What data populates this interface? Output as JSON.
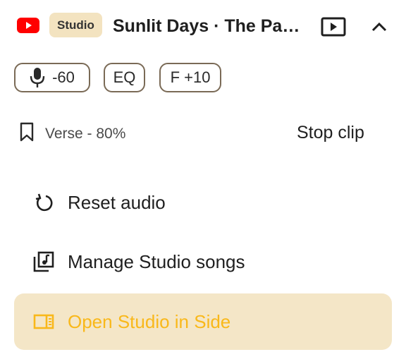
{
  "header": {
    "badge": "Studio",
    "title": "Sunlit Days · The Paper Lanterns",
    "logo_icon": "youtube-logo-icon",
    "video_icon": "video-play-icon",
    "collapse_icon": "chevron-up-icon"
  },
  "chips": {
    "mic": {
      "icon": "microphone-icon",
      "label": "-60"
    },
    "eq": {
      "label": "EQ"
    },
    "f": {
      "label": "F +10"
    }
  },
  "bookmark": {
    "icon": "bookmark-icon",
    "label": "Verse - 80%",
    "stop_label": "Stop clip"
  },
  "menu": {
    "items": [
      {
        "icon": "reset-icon",
        "label": "Reset audio"
      },
      {
        "icon": "library-music-icon",
        "label": "Manage Studio songs"
      },
      {
        "icon": "side-panel-icon",
        "label": "Open Studio in Side"
      }
    ]
  },
  "colors": {
    "accent": "#f9b81a",
    "highlight_bg": "#f4e6c7",
    "badge_bg": "#f3e3c0",
    "chip_border": "#7a6a56",
    "youtube_red": "#ff0000"
  }
}
